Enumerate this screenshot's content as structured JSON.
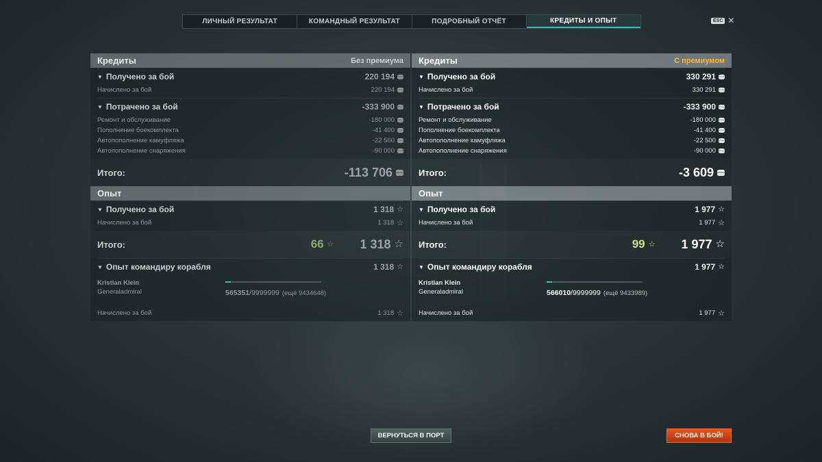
{
  "tabs": [
    {
      "label": "ЛИЧНЫЙ РЕЗУЛЬТАТ"
    },
    {
      "label": "КОМАНДНЫЙ РЕЗУЛЬТАТ"
    },
    {
      "label": "ПОДРОБНЫЙ ОТЧЁТ"
    },
    {
      "label": "КРЕДИТЫ И ОПЫТ",
      "active": true
    }
  ],
  "esc": {
    "key": "ESC",
    "close": "✕"
  },
  "left": {
    "credits": {
      "title": "Кредиты",
      "mode": "Без премиума",
      "earned": {
        "label": "Получено за бой",
        "value": "220 194"
      },
      "earned_rows": [
        {
          "label": "Начислено за бой",
          "value": "220 194"
        }
      ],
      "spent": {
        "label": "Потрачено за бой",
        "value": "-333 900"
      },
      "spent_rows": [
        {
          "label": "Ремонт и обслуживание",
          "value": "-180 000"
        },
        {
          "label": "Пополнение боекомплекта",
          "value": "-41 400"
        },
        {
          "label": "Автопополнение камуфляжа",
          "value": "-22 500"
        },
        {
          "label": "Автопополнение снаряжения",
          "value": "-90 000"
        }
      ],
      "total": {
        "label": "Итого:",
        "value": "-113 706"
      }
    },
    "xp": {
      "title": "Опыт",
      "earned": {
        "label": "Получено за бой",
        "value": "1 318"
      },
      "earned_rows": [
        {
          "label": "Начислено за бой",
          "value": "1 318"
        }
      ],
      "total": {
        "label": "Итого:",
        "bonus": "66",
        "value": "1 318"
      },
      "commander": {
        "label": "Опыт командиру корабля",
        "value": "1 318",
        "name": "Kristian Klein",
        "rank": "Generaladmiral",
        "xp_current": "565351",
        "xp_max": "/9999999",
        "xp_remaining": "(ещё 9434648)",
        "progress": 0.0565,
        "row": {
          "label": "Начислено за бой",
          "value": "1 318"
        }
      }
    }
  },
  "right": {
    "credits": {
      "title": "Кредиты",
      "mode": "С премиумом",
      "earned": {
        "label": "Получено за бой",
        "value": "330 291"
      },
      "earned_rows": [
        {
          "label": "Начислено за бой",
          "value": "330 291"
        }
      ],
      "spent": {
        "label": "Потрачено за бой",
        "value": "-333 900"
      },
      "spent_rows": [
        {
          "label": "Ремонт и обслуживание",
          "value": "-180 000"
        },
        {
          "label": "Пополнение боекомплекта",
          "value": "-41 400"
        },
        {
          "label": "Автопополнение камуфляжа",
          "value": "-22 500"
        },
        {
          "label": "Автопополнение снаряжения",
          "value": "-90 000"
        }
      ],
      "total": {
        "label": "Итого:",
        "value": "-3 609"
      }
    },
    "xp": {
      "title": "Опыт",
      "earned": {
        "label": "Получено за бой",
        "value": "1 977"
      },
      "earned_rows": [
        {
          "label": "Начислено за бой",
          "value": "1 977"
        }
      ],
      "total": {
        "label": "Итого:",
        "bonus": "99",
        "value": "1 977"
      },
      "commander": {
        "label": "Опыт командиру корабля",
        "value": "1 977",
        "name": "Kristian Klein",
        "rank": "Generaladmiral",
        "xp_current": "566010",
        "xp_max": "/9999999",
        "xp_remaining": "(ещё 9433989)",
        "progress": 0.0566,
        "row": {
          "label": "Начислено за бой",
          "value": "1 977"
        }
      }
    }
  },
  "buttons": {
    "port": "ВЕРНУТЬСЯ В ПОРТ",
    "battle": "СНОВА В БОЙ!"
  },
  "colors": {
    "accent": "#2cc3b3",
    "premium": "#ffb52a",
    "battle_button": "#d8431a",
    "xp_bonus": "#cde67a"
  },
  "icons": {
    "credits": "silver-coin-icon",
    "xp": "star-outline-icon",
    "expand": "triangle-down-icon",
    "close": "close-icon"
  }
}
